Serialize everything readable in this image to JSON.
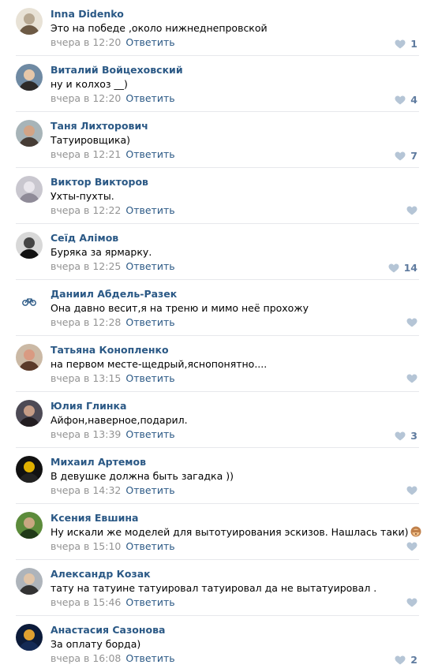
{
  "reply_label": "Ответить",
  "accent_color": "#2a5885",
  "like_color": "#b5c5d6",
  "comments": [
    {
      "author": "Inna Didenko",
      "text": "Это на победе ,около нижнеднепровской",
      "time": "вчера в 12:20",
      "likes": "1",
      "avatar_colors": [
        "#e8e2d6",
        "#b7a892",
        "#6d5a45"
      ]
    },
    {
      "author": "Виталий Войцеховский",
      "text": "ну и колхоз __)",
      "time": "вчера в 12:20",
      "likes": "4",
      "avatar_colors": [
        "#6f8aa3",
        "#e6c7a9",
        "#2d2a28"
      ]
    },
    {
      "author": "Таня Лихторович",
      "text": "Татуировщика)",
      "time": "вчера в 12:21",
      "likes": "7",
      "avatar_colors": [
        "#a7b4b8",
        "#d2a486",
        "#463c35"
      ]
    },
    {
      "author": "Виктор Викторов",
      "text": "Ухты-пухты.",
      "time": "вчера в 12:22",
      "likes": "",
      "avatar_colors": [
        "#c9c7cf",
        "#e9e6ec",
        "#8f8b98"
      ]
    },
    {
      "author": "Сеїд Алімов",
      "text": "Буряка за ярмарку.",
      "time": "вчера в 12:25",
      "likes": "14",
      "avatar_colors": [
        "#d8d8d8",
        "#444",
        "#111"
      ]
    },
    {
      "author": "Даниил Абдель-Разек",
      "text": "Она давно весит,я на треню и мимо неё прохожу",
      "time": "вчера в 12:28",
      "likes": "",
      "avatar_colors": [
        "#ffffff",
        "#2a5885",
        "#2a5885"
      ]
    },
    {
      "author": "Татьяна Конопленко",
      "text": "на первом месте-щедрый,яснопонятно....",
      "time": "вчера в 13:15",
      "likes": "",
      "avatar_colors": [
        "#cbb9a5",
        "#d99a82",
        "#5a3a2a"
      ]
    },
    {
      "author": "Юлия Глинка",
      "text": "Айфон,наверное,подарил.",
      "time": "вчера в 13:39",
      "likes": "3",
      "avatar_colors": [
        "#4d4a55",
        "#c59c86",
        "#221d21"
      ]
    },
    {
      "author": "Михаил Артемов",
      "text": "В девушке должна быть загадка ))",
      "time": "вчера в 14:32",
      "likes": "",
      "avatar_colors": [
        "#111",
        "#e0b000",
        "#222"
      ]
    },
    {
      "author": "Ксения Евшина",
      "text": "Ну искали же моделей для вытотуирования эскизов. Нашлась таки)",
      "time": "вчера в 15:10",
      "likes": "",
      "avatar_colors": [
        "#5c8b3b",
        "#c9a781",
        "#203a18"
      ]
    },
    {
      "author": "Александр Козак",
      "text": "тату на татуине татуировал татуировал да не вытатуировал .",
      "time": "вчера в 15:46",
      "likes": "",
      "avatar_colors": [
        "#aeb4bb",
        "#e0c4a8",
        "#333"
      ]
    },
    {
      "author": "Анастасия Сазонова",
      "text": "За оплату борда)",
      "time": "вчера в 16:08",
      "likes": "2",
      "avatar_colors": [
        "#0c1b3a",
        "#e0a030",
        "#142a55"
      ]
    }
  ]
}
